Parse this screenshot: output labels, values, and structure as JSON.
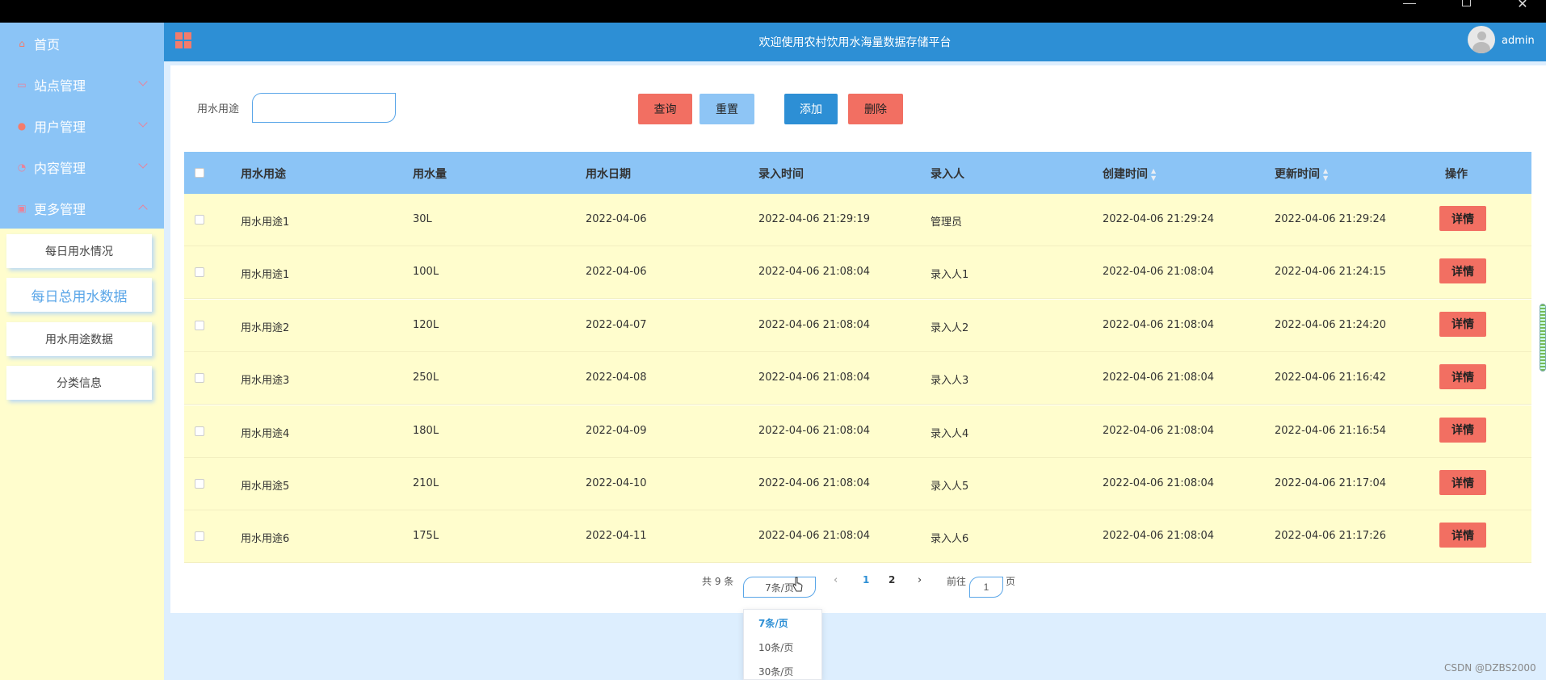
{
  "header": {
    "title": "欢迎使用农村饮用水海量数据存储平台",
    "user": "admin"
  },
  "sidebar": {
    "items": [
      {
        "label": "首页",
        "icon": "⌂"
      },
      {
        "label": "站点管理",
        "icon": "▭"
      },
      {
        "label": "用户管理",
        "icon": "●"
      },
      {
        "label": "内容管理",
        "icon": "◔"
      },
      {
        "label": "更多管理",
        "icon": "▣"
      }
    ],
    "subitems": [
      {
        "label": "每日用水情况"
      },
      {
        "label": "每日总用水数据"
      },
      {
        "label": "用水用途数据"
      },
      {
        "label": "分类信息"
      }
    ]
  },
  "search": {
    "label": "用水用途",
    "value": ""
  },
  "buttons": {
    "query": "查询",
    "reset": "重置",
    "add": "添加",
    "delete": "删除"
  },
  "table": {
    "headers": [
      "用水用途",
      "用水量",
      "用水日期",
      "录入时间",
      "录入人",
      "创建时间",
      "更新时间",
      "操作"
    ],
    "detail_label": "详情",
    "rows": [
      [
        "用水用途1",
        "30L",
        "2022-04-06",
        "2022-04-06 21:29:19",
        "管理员",
        "2022-04-06 21:29:24",
        "2022-04-06 21:29:24"
      ],
      [
        "用水用途1",
        "100L",
        "2022-04-06",
        "2022-04-06 21:08:04",
        "录入人1",
        "2022-04-06 21:08:04",
        "2022-04-06 21:24:15"
      ],
      [
        "用水用途2",
        "120L",
        "2022-04-07",
        "2022-04-06 21:08:04",
        "录入人2",
        "2022-04-06 21:08:04",
        "2022-04-06 21:24:20"
      ],
      [
        "用水用途3",
        "250L",
        "2022-04-08",
        "2022-04-06 21:08:04",
        "录入人3",
        "2022-04-06 21:08:04",
        "2022-04-06 21:16:42"
      ],
      [
        "用水用途4",
        "180L",
        "2022-04-09",
        "2022-04-06 21:08:04",
        "录入人4",
        "2022-04-06 21:08:04",
        "2022-04-06 21:16:54"
      ],
      [
        "用水用途5",
        "210L",
        "2022-04-10",
        "2022-04-06 21:08:04",
        "录入人5",
        "2022-04-06 21:08:04",
        "2022-04-06 21:17:04"
      ],
      [
        "用水用途6",
        "175L",
        "2022-04-11",
        "2022-04-06 21:08:04",
        "录入人6",
        "2022-04-06 21:08:04",
        "2022-04-06 21:17:26"
      ]
    ]
  },
  "pagination": {
    "total": "共 9 条",
    "page_size": "7条/页",
    "pages": [
      "1",
      "2"
    ],
    "goto_label": "前往",
    "goto_value": "1",
    "page_suffix": "页",
    "size_options": [
      "7条/页",
      "10条/页",
      "30条/页"
    ]
  },
  "watermark": "CSDN @DZBS2000",
  "colors": {
    "sidebar_bg": "#fffdcd",
    "nav_blue": "#8bc4f6",
    "header_blue": "#2d8fd5",
    "danger": "#f26f62"
  }
}
